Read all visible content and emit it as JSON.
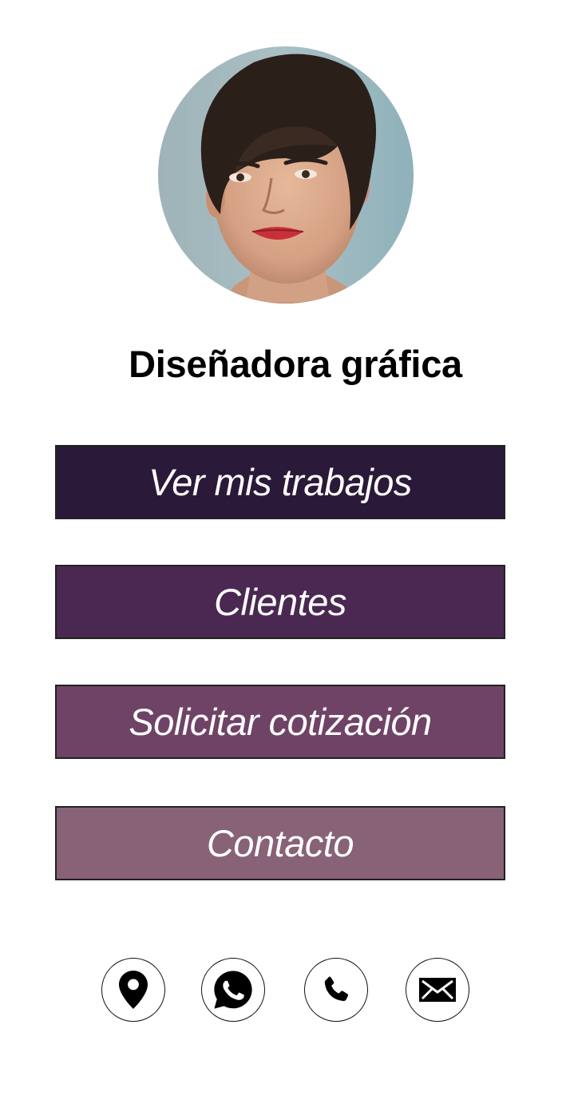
{
  "profile": {
    "title": "Diseñadora gráfica",
    "avatar_icon": "profile-photo"
  },
  "menu": {
    "buttons": [
      {
        "label": "Ver mis trabajos",
        "color": "#2a1938"
      },
      {
        "label": "Clientes",
        "color": "#4a2851"
      },
      {
        "label": "Solicitar cotización",
        "color": "#6f4366"
      },
      {
        "label": "Contacto",
        "color": "#886276"
      }
    ]
  },
  "social": {
    "icons": [
      "location-pin-icon",
      "whatsapp-icon",
      "phone-icon",
      "mail-icon"
    ]
  }
}
